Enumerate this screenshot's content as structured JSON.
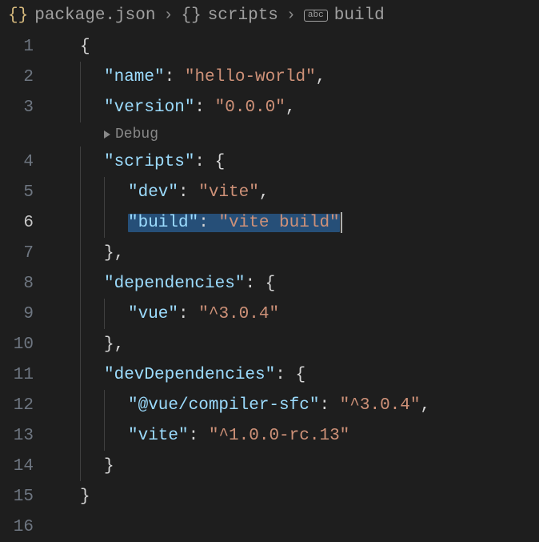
{
  "breadcrumbs": {
    "items": [
      {
        "icon": "{}",
        "label": "package.json"
      },
      {
        "icon": "{}",
        "label": "scripts"
      },
      {
        "icon": "abc",
        "label": "build"
      }
    ]
  },
  "codelens": {
    "debug": "Debug"
  },
  "lines": {
    "n1": "1",
    "n2": "2",
    "n3": "3",
    "n4": "4",
    "n5": "5",
    "n6": "6",
    "n7": "7",
    "n8": "8",
    "n9": "9",
    "n10": "10",
    "n11": "11",
    "n12": "12",
    "n13": "13",
    "n14": "14",
    "n15": "15",
    "n16": "16"
  },
  "code": {
    "l1": {
      "brace": "{"
    },
    "l2": {
      "key": "\"name\"",
      "colon": ": ",
      "val": "\"hello-world\"",
      "comma": ","
    },
    "l3": {
      "key": "\"version\"",
      "colon": ": ",
      "val": "\"0.0.0\"",
      "comma": ","
    },
    "l4": {
      "key": "\"scripts\"",
      "colon": ": ",
      "brace": "{"
    },
    "l5": {
      "key": "\"dev\"",
      "colon": ": ",
      "val": "\"vite\"",
      "comma": ","
    },
    "l6": {
      "key": "\"build\"",
      "colon": ": ",
      "val": "\"vite build\""
    },
    "l7": {
      "brace": "}",
      "comma": ","
    },
    "l8": {
      "key": "\"dependencies\"",
      "colon": ": ",
      "brace": "{"
    },
    "l9": {
      "key": "\"vue\"",
      "colon": ": ",
      "val": "\"^3.0.4\""
    },
    "l10": {
      "brace": "}",
      "comma": ","
    },
    "l11": {
      "key": "\"devDependencies\"",
      "colon": ": ",
      "brace": "{"
    },
    "l12": {
      "key": "\"@vue/compiler-sfc\"",
      "colon": ": ",
      "val": "\"^3.0.4\"",
      "comma": ","
    },
    "l13": {
      "key": "\"vite\"",
      "colon": ": ",
      "val": "\"^1.0.0-rc.13\""
    },
    "l14": {
      "brace": "}"
    },
    "l15": {
      "brace": "}"
    }
  }
}
